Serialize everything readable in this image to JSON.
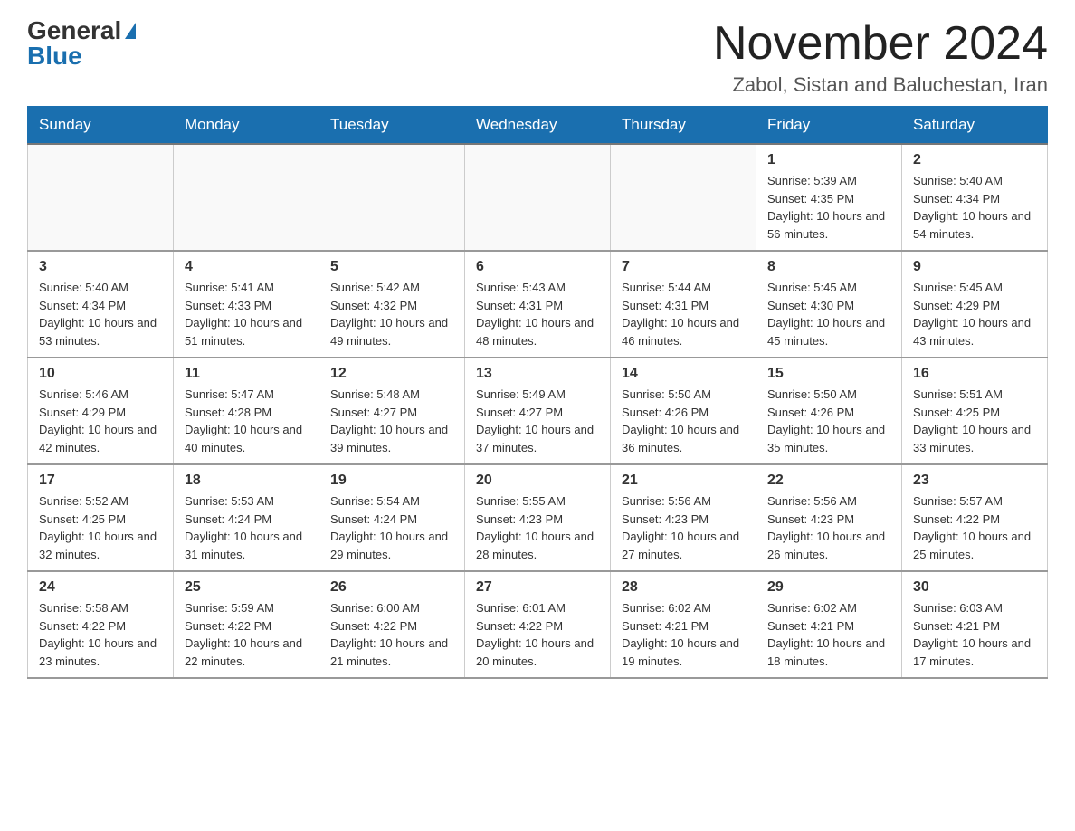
{
  "header": {
    "logo_general": "General",
    "logo_blue": "Blue",
    "month_title": "November 2024",
    "location": "Zabol, Sistan and Baluchestan, Iran"
  },
  "weekdays": [
    "Sunday",
    "Monday",
    "Tuesday",
    "Wednesday",
    "Thursday",
    "Friday",
    "Saturday"
  ],
  "weeks": [
    [
      {
        "day": "",
        "info": ""
      },
      {
        "day": "",
        "info": ""
      },
      {
        "day": "",
        "info": ""
      },
      {
        "day": "",
        "info": ""
      },
      {
        "day": "",
        "info": ""
      },
      {
        "day": "1",
        "info": "Sunrise: 5:39 AM\nSunset: 4:35 PM\nDaylight: 10 hours and 56 minutes."
      },
      {
        "day": "2",
        "info": "Sunrise: 5:40 AM\nSunset: 4:34 PM\nDaylight: 10 hours and 54 minutes."
      }
    ],
    [
      {
        "day": "3",
        "info": "Sunrise: 5:40 AM\nSunset: 4:34 PM\nDaylight: 10 hours and 53 minutes."
      },
      {
        "day": "4",
        "info": "Sunrise: 5:41 AM\nSunset: 4:33 PM\nDaylight: 10 hours and 51 minutes."
      },
      {
        "day": "5",
        "info": "Sunrise: 5:42 AM\nSunset: 4:32 PM\nDaylight: 10 hours and 49 minutes."
      },
      {
        "day": "6",
        "info": "Sunrise: 5:43 AM\nSunset: 4:31 PM\nDaylight: 10 hours and 48 minutes."
      },
      {
        "day": "7",
        "info": "Sunrise: 5:44 AM\nSunset: 4:31 PM\nDaylight: 10 hours and 46 minutes."
      },
      {
        "day": "8",
        "info": "Sunrise: 5:45 AM\nSunset: 4:30 PM\nDaylight: 10 hours and 45 minutes."
      },
      {
        "day": "9",
        "info": "Sunrise: 5:45 AM\nSunset: 4:29 PM\nDaylight: 10 hours and 43 minutes."
      }
    ],
    [
      {
        "day": "10",
        "info": "Sunrise: 5:46 AM\nSunset: 4:29 PM\nDaylight: 10 hours and 42 minutes."
      },
      {
        "day": "11",
        "info": "Sunrise: 5:47 AM\nSunset: 4:28 PM\nDaylight: 10 hours and 40 minutes."
      },
      {
        "day": "12",
        "info": "Sunrise: 5:48 AM\nSunset: 4:27 PM\nDaylight: 10 hours and 39 minutes."
      },
      {
        "day": "13",
        "info": "Sunrise: 5:49 AM\nSunset: 4:27 PM\nDaylight: 10 hours and 37 minutes."
      },
      {
        "day": "14",
        "info": "Sunrise: 5:50 AM\nSunset: 4:26 PM\nDaylight: 10 hours and 36 minutes."
      },
      {
        "day": "15",
        "info": "Sunrise: 5:50 AM\nSunset: 4:26 PM\nDaylight: 10 hours and 35 minutes."
      },
      {
        "day": "16",
        "info": "Sunrise: 5:51 AM\nSunset: 4:25 PM\nDaylight: 10 hours and 33 minutes."
      }
    ],
    [
      {
        "day": "17",
        "info": "Sunrise: 5:52 AM\nSunset: 4:25 PM\nDaylight: 10 hours and 32 minutes."
      },
      {
        "day": "18",
        "info": "Sunrise: 5:53 AM\nSunset: 4:24 PM\nDaylight: 10 hours and 31 minutes."
      },
      {
        "day": "19",
        "info": "Sunrise: 5:54 AM\nSunset: 4:24 PM\nDaylight: 10 hours and 29 minutes."
      },
      {
        "day": "20",
        "info": "Sunrise: 5:55 AM\nSunset: 4:23 PM\nDaylight: 10 hours and 28 minutes."
      },
      {
        "day": "21",
        "info": "Sunrise: 5:56 AM\nSunset: 4:23 PM\nDaylight: 10 hours and 27 minutes."
      },
      {
        "day": "22",
        "info": "Sunrise: 5:56 AM\nSunset: 4:23 PM\nDaylight: 10 hours and 26 minutes."
      },
      {
        "day": "23",
        "info": "Sunrise: 5:57 AM\nSunset: 4:22 PM\nDaylight: 10 hours and 25 minutes."
      }
    ],
    [
      {
        "day": "24",
        "info": "Sunrise: 5:58 AM\nSunset: 4:22 PM\nDaylight: 10 hours and 23 minutes."
      },
      {
        "day": "25",
        "info": "Sunrise: 5:59 AM\nSunset: 4:22 PM\nDaylight: 10 hours and 22 minutes."
      },
      {
        "day": "26",
        "info": "Sunrise: 6:00 AM\nSunset: 4:22 PM\nDaylight: 10 hours and 21 minutes."
      },
      {
        "day": "27",
        "info": "Sunrise: 6:01 AM\nSunset: 4:22 PM\nDaylight: 10 hours and 20 minutes."
      },
      {
        "day": "28",
        "info": "Sunrise: 6:02 AM\nSunset: 4:21 PM\nDaylight: 10 hours and 19 minutes."
      },
      {
        "day": "29",
        "info": "Sunrise: 6:02 AM\nSunset: 4:21 PM\nDaylight: 10 hours and 18 minutes."
      },
      {
        "day": "30",
        "info": "Sunrise: 6:03 AM\nSunset: 4:21 PM\nDaylight: 10 hours and 17 minutes."
      }
    ]
  ]
}
